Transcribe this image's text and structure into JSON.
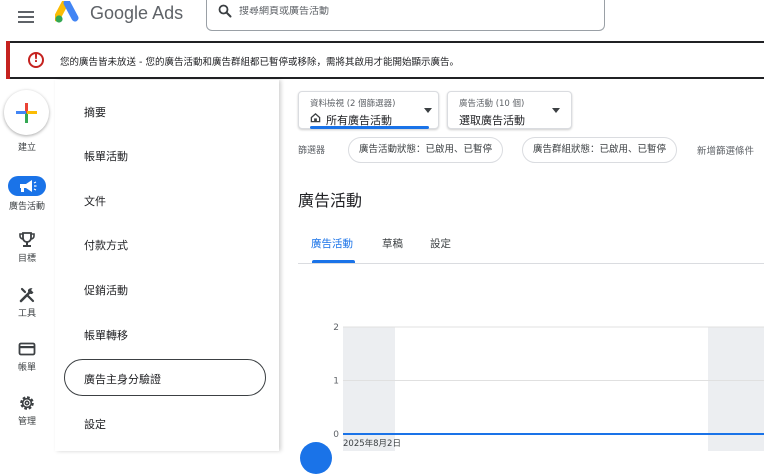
{
  "header": {
    "brand_google": "Google",
    "brand_ads": "Ads",
    "search_placeholder": "搜尋網頁或廣告活動"
  },
  "alert": {
    "text": "您的廣告皆未放送 - 您的廣告活動和廣告群組都已暫停或移除，需將其啟用才能開始顯示廣告。"
  },
  "rail": {
    "items": [
      {
        "label": "建立",
        "icon": "plus-icon"
      },
      {
        "label": "廣告活動",
        "icon": "megaphone-icon"
      },
      {
        "label": "目標",
        "icon": "trophy-icon"
      },
      {
        "label": "工具",
        "icon": "tools-icon"
      },
      {
        "label": "帳單",
        "icon": "credit-card-icon"
      },
      {
        "label": "管理",
        "icon": "gear-icon"
      }
    ]
  },
  "flyout": {
    "items": [
      "摘要",
      "帳單活動",
      "文件",
      "付款方式",
      "促銷活動",
      "帳單轉移",
      "廣告主身分驗證",
      "設定"
    ],
    "selected_index": 6
  },
  "toolbar": {
    "view_small": "資料檢視 (2 個篩選器)",
    "view_value": "所有廣告活動",
    "campaign_small": "廣告活動 (10 個)",
    "campaign_value": "選取廣告活動"
  },
  "filters": {
    "label": "篩選器",
    "chips": [
      "廣告活動狀態：已啟用、已暫停",
      "廣告群組狀態：已啟用、已暫停"
    ],
    "add_filter": "新增篩選條件"
  },
  "page": {
    "title": "廣告活動",
    "tabs": [
      "廣告活動",
      "草稿",
      "設定"
    ],
    "active_tab": 0
  },
  "colors": {
    "accent": "#1a73e8",
    "alert": "#c5221f"
  },
  "chart_data": {
    "type": "line",
    "x": [
      "2025年8月2日"
    ],
    "series": [
      {
        "values": [
          0
        ]
      }
    ],
    "yticks": [
      "0",
      "1",
      "2"
    ],
    "ylim": [
      0,
      2
    ],
    "grid": true
  }
}
